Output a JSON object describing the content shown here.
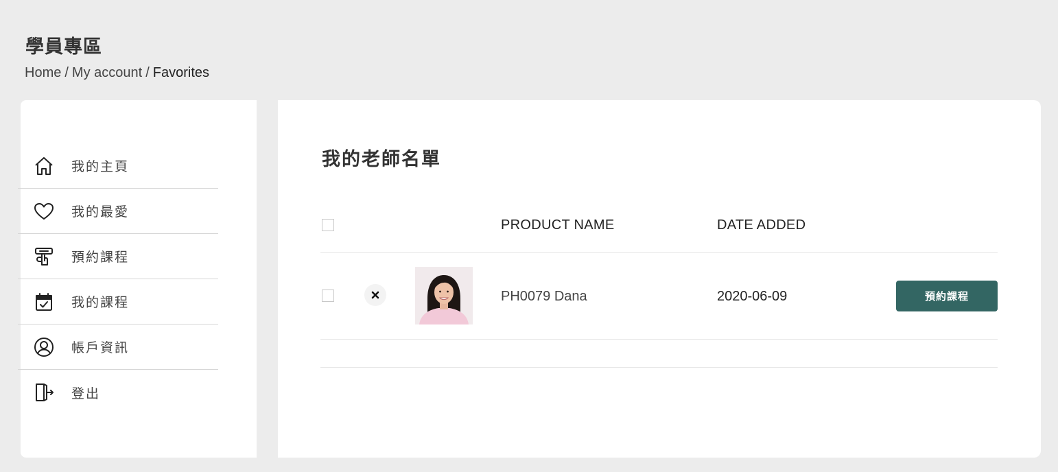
{
  "header": {
    "title": "學員專區",
    "breadcrumb": {
      "items": [
        "Home",
        "My account"
      ],
      "separator": "/",
      "current": "Favorites"
    }
  },
  "sidebar": {
    "items": [
      {
        "label": "我的主頁",
        "icon": "home-icon"
      },
      {
        "label": "我的最愛",
        "icon": "heart-icon"
      },
      {
        "label": "預約課程",
        "icon": "booking-hand-icon"
      },
      {
        "label": "我的課程",
        "icon": "calendar-check-icon"
      },
      {
        "label": "帳戶資訊",
        "icon": "user-circle-icon"
      },
      {
        "label": "登出",
        "icon": "logout-door-icon"
      }
    ]
  },
  "main": {
    "title": "我的老師名單",
    "table": {
      "columns": [
        "PRODUCT NAME",
        "DATE ADDED"
      ],
      "rows": [
        {
          "product_name": "PH0079 Dana",
          "date_added": "2020-06-09",
          "action_label": "預約課程",
          "remove_icon": "close-icon",
          "thumbnail_icon": "teacher-photo"
        }
      ]
    }
  },
  "colors": {
    "page_background": "#ececec",
    "panel_background": "#ffffff",
    "button_background": "#336663",
    "button_text": "#ffffff",
    "divider": "#d6d6d6"
  }
}
